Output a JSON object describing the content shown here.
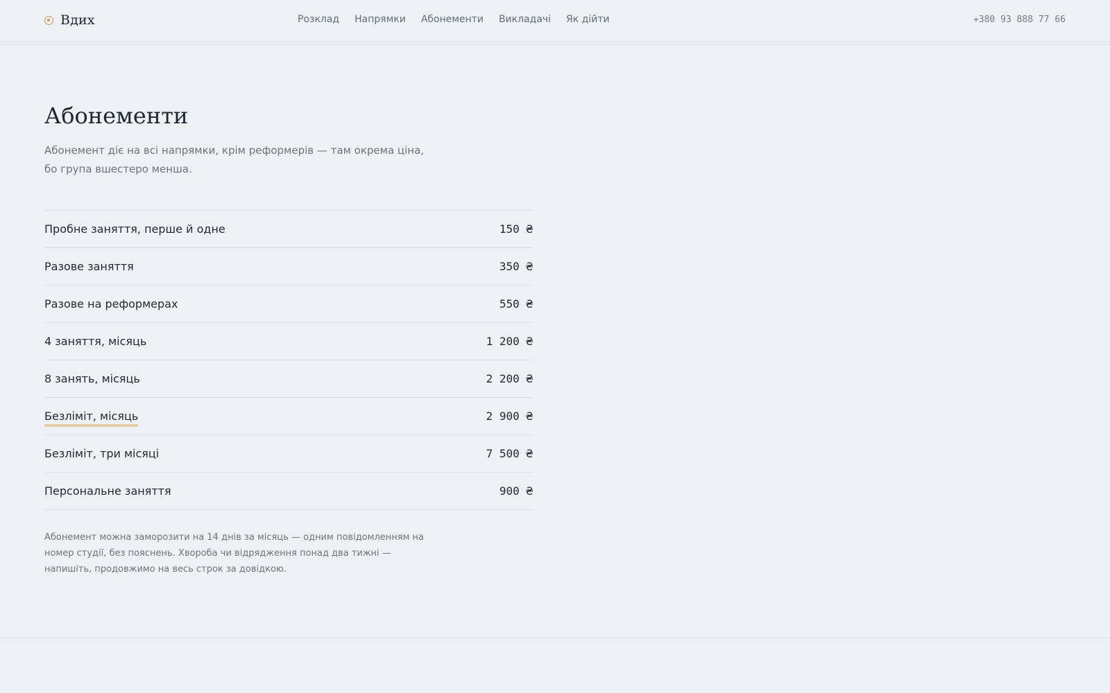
{
  "brand": {
    "name": "Вдих",
    "accent": "#c99a62"
  },
  "nav": {
    "items": [
      "Розклад",
      "Напрямки",
      "Абонементи",
      "Викладачі",
      "Як дійти"
    ]
  },
  "contact": {
    "phone": "+380 93 888 77 66"
  },
  "page": {
    "title": "Абонементи",
    "intro": "Абонемент діє на всі напрямки, крім реформерів — там окрема ціна, бо група вшестеро менша.",
    "note": "Абонемент можна заморозити на 14 днів за місяць — одним повідомленням на номер студії, без пояснень. Хвороба чи відрядження понад два тижні — напишіть, продовжимо на весь строк за довідкою."
  },
  "prices": [
    {
      "label": "Пробне заняття, перше й одне",
      "value": "150 ₴"
    },
    {
      "label": "Разове заняття",
      "value": "350 ₴"
    },
    {
      "label": "Разове на реформерах",
      "value": "550 ₴"
    },
    {
      "label": "4 заняття, місяць",
      "value": "1 200 ₴"
    },
    {
      "label": "8 занять, місяць",
      "value": "2 200 ₴"
    },
    {
      "label": "Безліміт, місяць",
      "value": "2 900 ₴",
      "highlighted": true
    },
    {
      "label": "Безліміт, три місяці",
      "value": "7 500 ₴"
    },
    {
      "label": "Персональне заняття",
      "value": "900 ₴"
    }
  ]
}
